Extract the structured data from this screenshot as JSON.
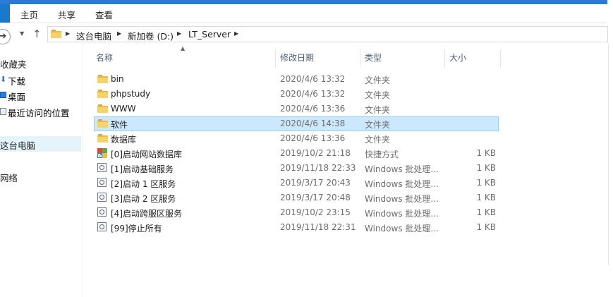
{
  "ribbon": {
    "tabs": [
      "主页",
      "共享",
      "查看"
    ]
  },
  "address": {
    "crumbs": [
      "这台电脑",
      "新加卷 (D:)",
      "LT_Server"
    ]
  },
  "nav_pane": {
    "items": [
      {
        "label": "收藏夹",
        "icon": "star-icon"
      },
      {
        "label": "下载",
        "icon": "download-icon"
      },
      {
        "label": "桌面",
        "icon": "desktop-icon"
      },
      {
        "label": "最近访问的位置",
        "icon": "recent-places-icon"
      },
      {
        "label": "这台电脑",
        "icon": "computer-icon",
        "selected": true
      },
      {
        "label": "网络",
        "icon": "network-icon"
      }
    ]
  },
  "columns": {
    "name": "名称",
    "date": "修改日期",
    "type": "类型",
    "size": "大小"
  },
  "files": [
    {
      "name": "bin",
      "date": "2020/4/6 13:32",
      "type": "文件夹",
      "size": "",
      "icon": "folder-icon",
      "selected": false
    },
    {
      "name": "phpstudy",
      "date": "2020/4/6 13:32",
      "type": "文件夹",
      "size": "",
      "icon": "folder-icon",
      "selected": false
    },
    {
      "name": "WWW",
      "date": "2020/4/6 13:36",
      "type": "文件夹",
      "size": "",
      "icon": "folder-icon",
      "selected": false
    },
    {
      "name": "软件",
      "date": "2020/4/6 14:38",
      "type": "文件夹",
      "size": "",
      "icon": "folder-icon",
      "selected": true
    },
    {
      "name": "数据库",
      "date": "2020/4/6 13:36",
      "type": "文件夹",
      "size": "",
      "icon": "folder-icon",
      "selected": false
    },
    {
      "name": "[0]启动网站数据库",
      "date": "2019/10/2 21:18",
      "type": "快捷方式",
      "size": "1 KB",
      "icon": "shortcut-icon",
      "selected": false
    },
    {
      "name": "[1]启动基础服务",
      "date": "2019/11/18 22:33",
      "type": "Windows 批处理...",
      "size": "1 KB",
      "icon": "batch-file-icon",
      "selected": false
    },
    {
      "name": "[2]启动 1 区服务",
      "date": "2019/3/17 20:43",
      "type": "Windows 批处理...",
      "size": "1 KB",
      "icon": "batch-file-icon",
      "selected": false
    },
    {
      "name": "[3]启动 2 区服务",
      "date": "2019/3/17 20:48",
      "type": "Windows 批处理...",
      "size": "1 KB",
      "icon": "batch-file-icon",
      "selected": false
    },
    {
      "name": "[4]启动跨服区服务",
      "date": "2019/10/2 23:15",
      "type": "Windows 批处理...",
      "size": "1 KB",
      "icon": "batch-file-icon",
      "selected": false
    },
    {
      "name": "[99]停止所有",
      "date": "2019/11/18 22:31",
      "type": "Windows 批处理...",
      "size": "1 KB",
      "icon": "batch-file-icon",
      "selected": false
    }
  ],
  "colors": {
    "accent": "#1979ca",
    "selection_bg": "#cce8ff",
    "selection_border": "#99d1ff",
    "folder": "#f6d26f"
  }
}
